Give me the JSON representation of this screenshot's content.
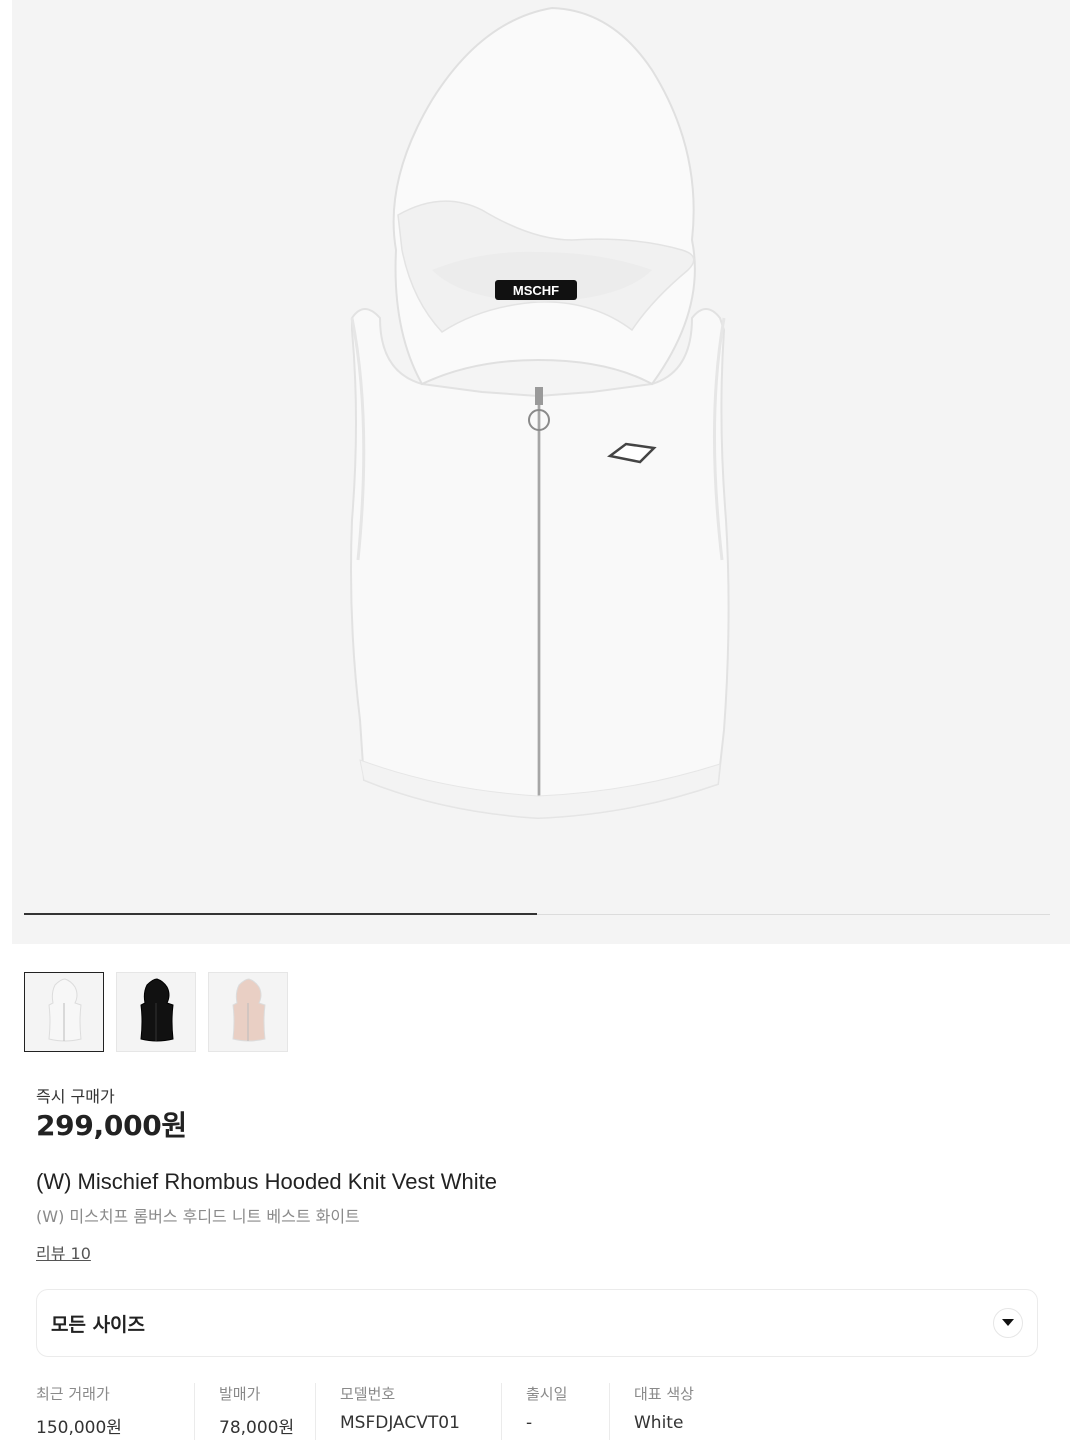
{
  "gallery": {
    "main_image": "white-hooded-knit-vest",
    "brand_tag": "MSCHF",
    "progress": 0.5,
    "thumbnails": [
      {
        "name": "white-vest-thumb",
        "color": "#f7f7f7",
        "active": true
      },
      {
        "name": "black-vest-thumb",
        "color": "#111111",
        "active": false
      },
      {
        "name": "pink-vest-thumb",
        "color": "#e9cfc4",
        "active": false
      }
    ]
  },
  "price": {
    "label": "즉시 구매가",
    "value": "299,000원"
  },
  "product": {
    "title_en": "(W) Mischief Rhombus Hooded Knit Vest White",
    "title_ko": "(W) 미스치프 롬버스 후디드 니트 베스트 화이트",
    "reviews": "리뷰 10"
  },
  "size_select": {
    "label": "모든 사이즈",
    "icon": "chevron-down-icon"
  },
  "info": [
    {
      "label": "최근 거래가",
      "value": "150,000원"
    },
    {
      "label": "발매가",
      "value": "78,000원"
    },
    {
      "label": "모델번호",
      "value": "MSFDJACVT01"
    },
    {
      "label": "출시일",
      "value": "-"
    },
    {
      "label": "대표 색상",
      "value": "White"
    }
  ]
}
